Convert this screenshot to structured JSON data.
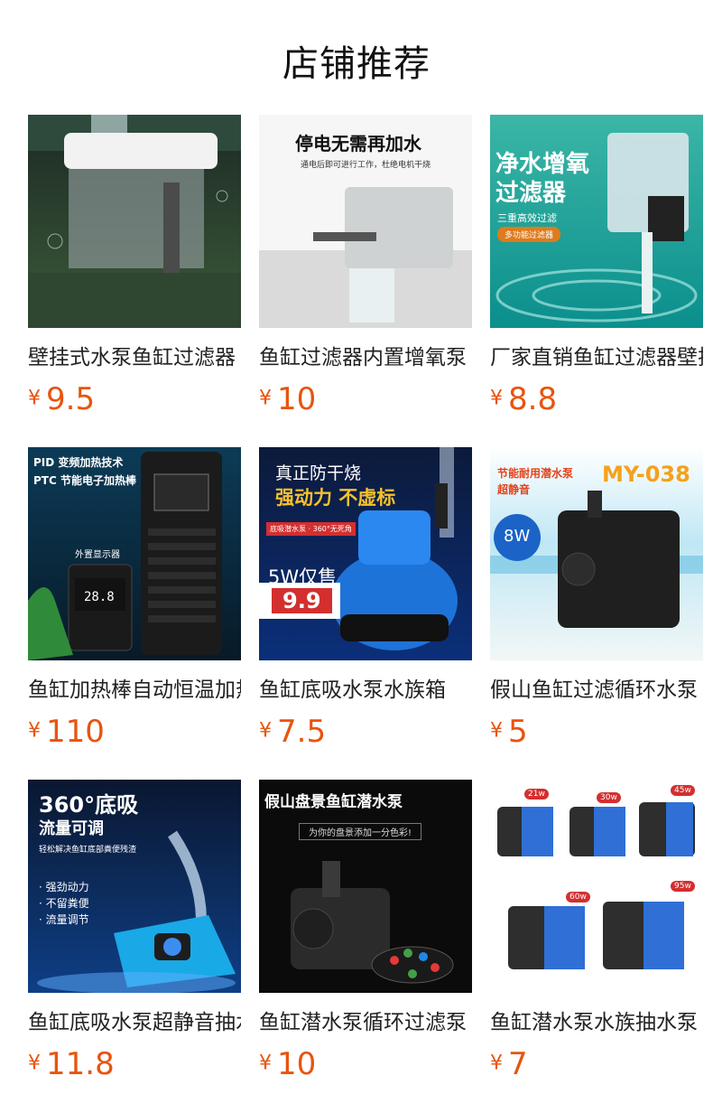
{
  "header": {
    "title": "店铺推荐"
  },
  "currency": "¥",
  "products": [
    {
      "name": "壁挂式水泵鱼缸过滤器",
      "price": "9.5",
      "overlay": []
    },
    {
      "name": "鱼缸过滤器内置增氧泵",
      "price": "10",
      "overlay": [
        "停电无需再加水",
        "通电后即可进行工作，杜绝电机干烧"
      ]
    },
    {
      "name": "厂家直销鱼缸过滤器壁挂",
      "price": "8.8",
      "overlay": [
        "净水增氧",
        "过滤器",
        "三重高效过滤",
        "多功能过滤器"
      ]
    },
    {
      "name": "鱼缸加热棒自动恒温加热",
      "price": "110",
      "overlay": [
        "PID 变频加热技术",
        "PTC 节能电子加热棒",
        "外置显示器",
        "28.8"
      ]
    },
    {
      "name": "鱼缸底吸水泵水族箱",
      "price": "7.5",
      "overlay": [
        "真正防干烧",
        "强动力 不虚标",
        "底吸潜水泵 · 360°无死角",
        "5W仅售",
        "9.9"
      ]
    },
    {
      "name": "假山鱼缸过滤循环水泵",
      "price": "5",
      "overlay": [
        "节能耐用潜水泵",
        "超静音",
        "MY-038",
        "8W"
      ]
    },
    {
      "name": "鱼缸底吸水泵超静音抽水",
      "price": "11.8",
      "overlay": [
        "360°底吸",
        "流量可调",
        "轻松解决鱼缸底部粪便残渣",
        "· 强劲动力",
        "· 不留粪便",
        "· 流量调节"
      ]
    },
    {
      "name": "鱼缸潜水泵循环过滤泵",
      "price": "10",
      "overlay": [
        "假山盘景鱼缸潜水泵",
        "为你的盘景添加一分色彩!"
      ]
    },
    {
      "name": "鱼缸潜水泵水族抽水泵",
      "price": "7",
      "overlay": [
        "21w",
        "30w",
        "45w",
        "60w",
        "95w"
      ]
    }
  ]
}
